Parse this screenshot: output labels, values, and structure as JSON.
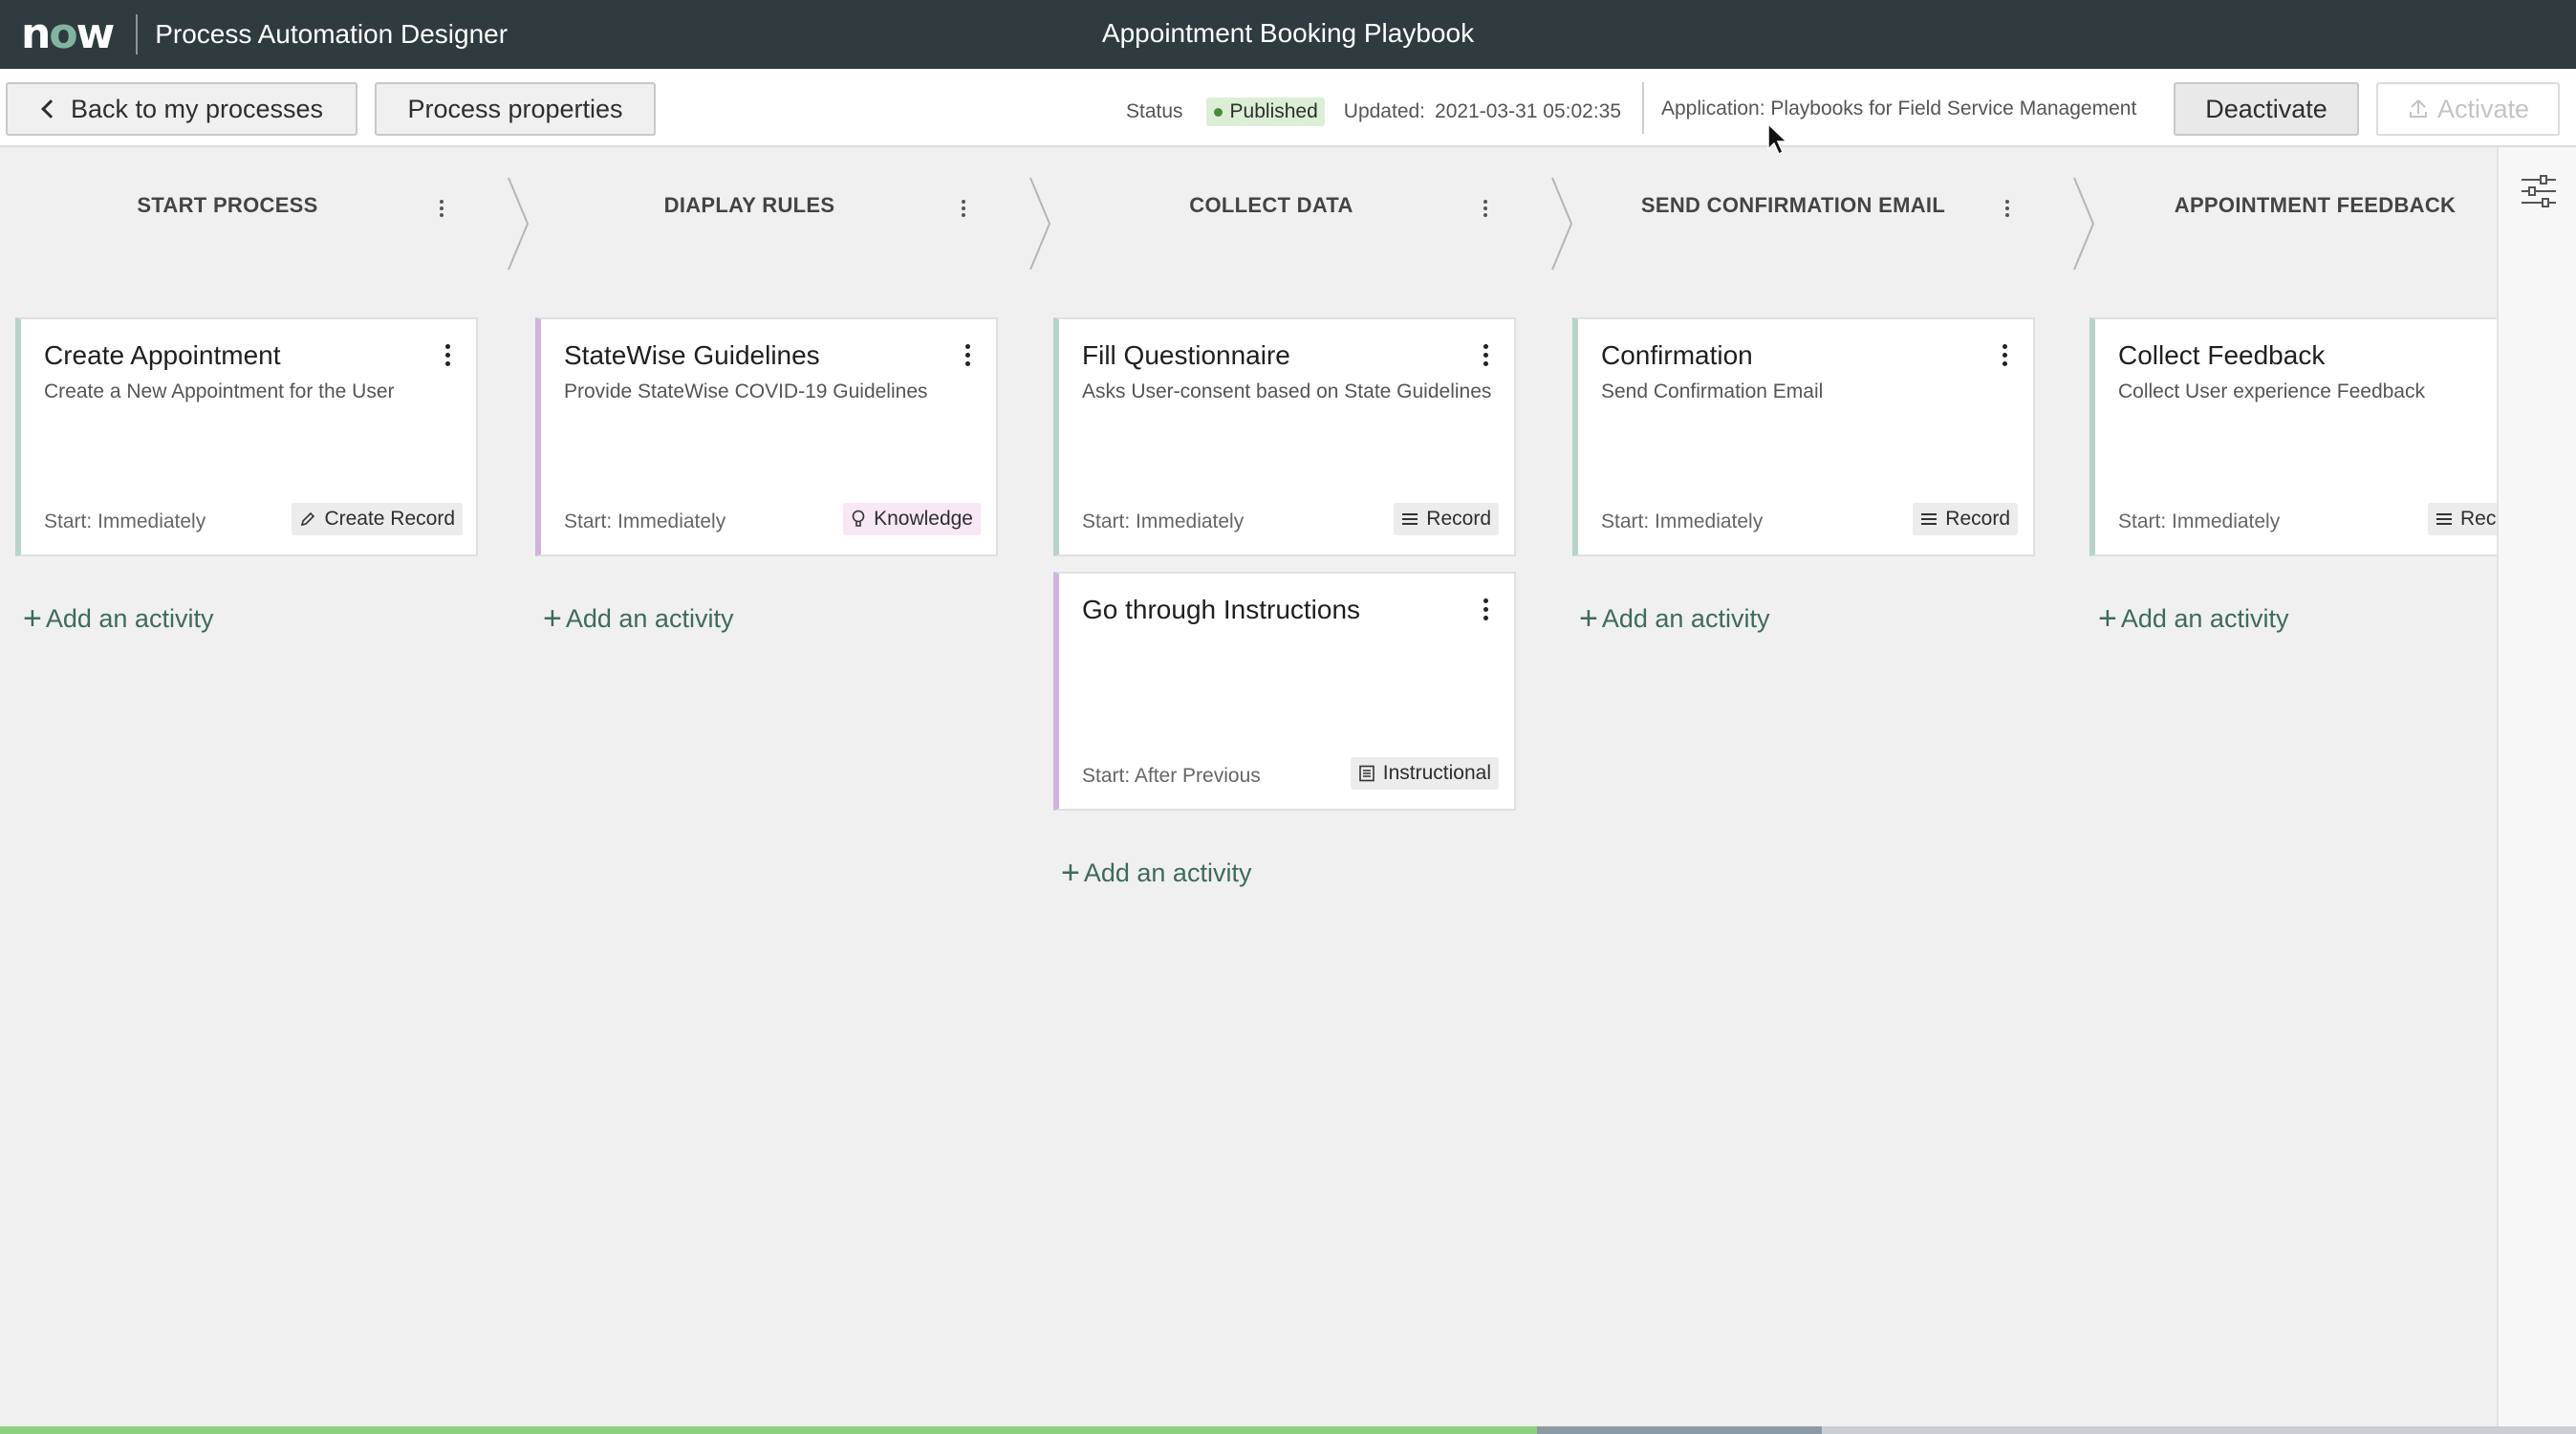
{
  "topbar": {
    "logo_n": "n",
    "logo_o": "o",
    "logo_w": "w",
    "app_title": "Process Automation Designer",
    "document_title": "Appointment Booking Playbook"
  },
  "toolbar": {
    "back_label": "Back to my processes",
    "properties_label": "Process properties",
    "status_label": "Status",
    "status_value": "Published",
    "updated_label": "Updated:",
    "updated_value": "2021-03-31 05:02:35",
    "application_label": "Application:",
    "application_value": "Playbooks for Field Service Management",
    "deactivate_label": "Deactivate",
    "activate_label": "Activate"
  },
  "lanes": [
    {
      "title": "START PROCESS",
      "cards": [
        {
          "title": "Create Appointment",
          "description": "Create a New Appointment for the User",
          "start": "Start: Immediately",
          "tag": "Create Record",
          "tag_icon": "pencil-icon"
        }
      ],
      "add_label": "Add an activity"
    },
    {
      "title": "DIAPLAY RULES",
      "cards": [
        {
          "title": "StateWise Guidelines",
          "description": "Provide StateWise COVID-19 Guidelines",
          "start": "Start: Immediately",
          "tag": "Knowledge",
          "tag_icon": "lightbulb-icon"
        }
      ],
      "add_label": "Add an activity"
    },
    {
      "title": "COLLECT DATA",
      "cards": [
        {
          "title": "Fill Questionnaire",
          "description": "Asks User-consent based on State Guidelines",
          "start": "Start: Immediately",
          "tag": "Record",
          "tag_icon": "list-icon"
        },
        {
          "title": "Go through Instructions",
          "description": "",
          "start": "Start: After Previous",
          "tag": "Instructional",
          "tag_icon": "document-icon"
        }
      ],
      "add_label": "Add an activity"
    },
    {
      "title": "SEND CONFIRMATION EMAIL",
      "cards": [
        {
          "title": "Confirmation",
          "description": "Send Confirmation Email",
          "start": "Start: Immediately",
          "tag": "Record",
          "tag_icon": "list-icon"
        }
      ],
      "add_label": "Add an activity"
    },
    {
      "title": "APPOINTMENT FEEDBACK",
      "cards": [
        {
          "title": "Collect Feedback",
          "description": "Collect User experience Feedback",
          "start": "Start: Immediately",
          "tag": "Rec",
          "tag_icon": "list-icon"
        }
      ],
      "add_label": "Add an activity"
    }
  ],
  "colors": {
    "topbar_bg": "#2f3b3f",
    "accent_green": "#81b5a1",
    "card_accent_green": "#b6d4c7",
    "card_accent_purple": "#d2b3e0",
    "published_badge": "#dcefd6"
  }
}
